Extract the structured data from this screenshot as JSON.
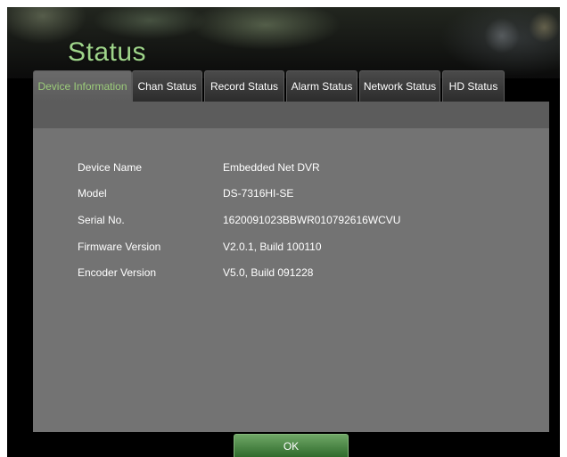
{
  "header": {
    "title": "Status"
  },
  "tabs": [
    {
      "label": "Device Information",
      "active": true
    },
    {
      "label": "Chan Status",
      "active": false
    },
    {
      "label": "Record Status",
      "active": false
    },
    {
      "label": "Alarm Status",
      "active": false
    },
    {
      "label": "Network Status",
      "active": false
    },
    {
      "label": "HD Status",
      "active": false
    }
  ],
  "device_info": [
    {
      "label": "Device Name",
      "value": "Embedded Net DVR"
    },
    {
      "label": "Model",
      "value": "DS-7316HI-SE"
    },
    {
      "label": "Serial No.",
      "value": "1620091023BBWR010792616WCVU"
    },
    {
      "label": "Firmware Version",
      "value": "V2.0.1, Build 100110"
    },
    {
      "label": "Encoder Version",
      "value": "V5.0, Build 091228"
    }
  ],
  "footer": {
    "ok_label": "OK"
  },
  "colors": {
    "title": "#9fd58a",
    "active_tab_text": "#9ccc7a",
    "panel": "#737373",
    "ok_button": "#4f8a48"
  }
}
